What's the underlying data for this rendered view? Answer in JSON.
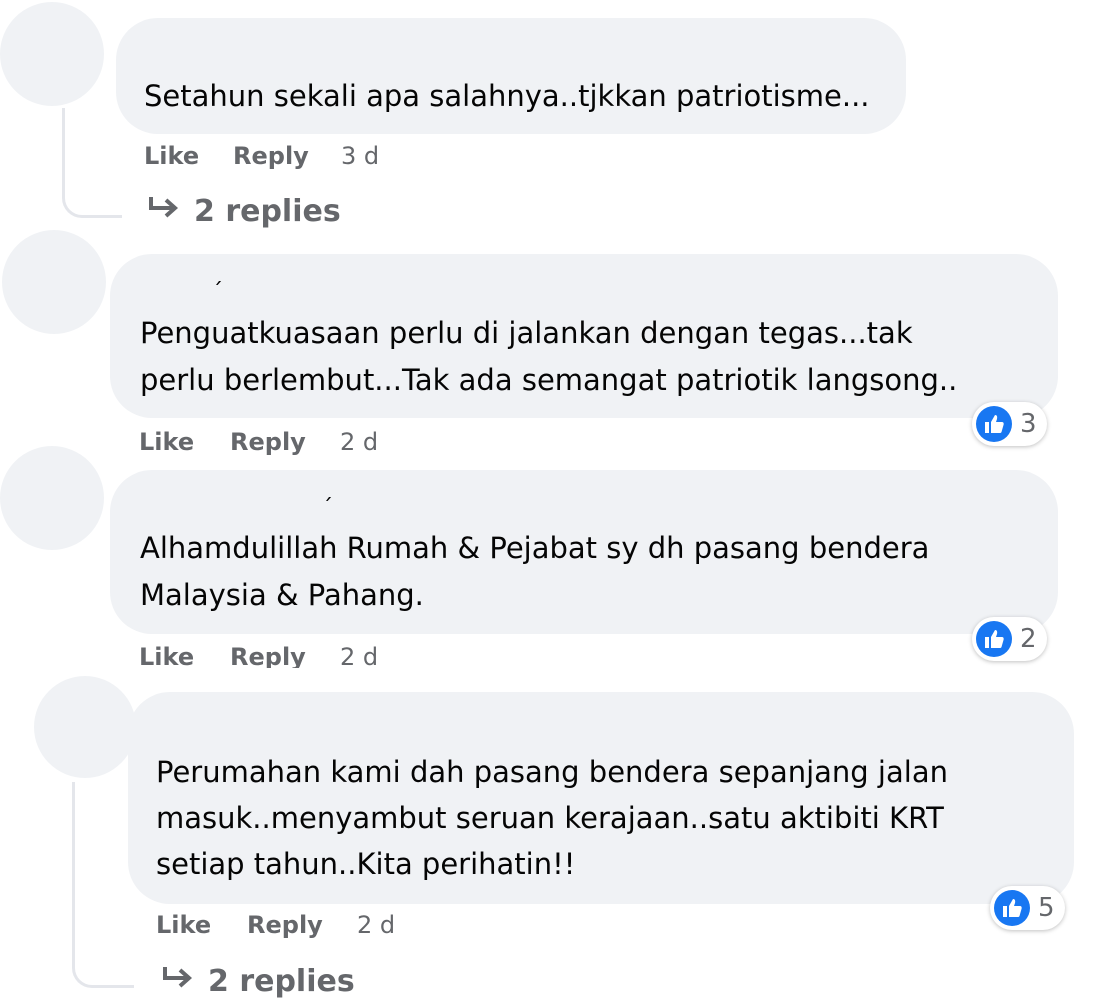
{
  "comments": [
    {
      "text_lines": [
        "Setahun sekali apa salahnya..tjkkan patriotisme..."
      ],
      "like_label": "Like",
      "reply_label": "Reply",
      "time": "3 d",
      "replies_label": "2 replies"
    },
    {
      "text_lines": [
        "Penguatkuasaan perlu di jalankan dengan tegas...tak",
        "perlu berlembut...Tak ada semangat patriotik langsong.."
      ],
      "like_label": "Like",
      "reply_label": "Reply",
      "time": "2 d",
      "reaction_count": "3"
    },
    {
      "text_lines": [
        "Alhamdulillah Rumah & Pejabat sy dh pasang bendera",
        "Malaysia & Pahang."
      ],
      "like_label": "Like",
      "reply_label": "Reply",
      "time": "2 d",
      "reaction_count": "2"
    },
    {
      "text_lines": [
        "Perumahan kami dah pasang bendera sepanjang jalan",
        "masuk..menyambut seruan kerajaan..satu aktibiti KRT",
        "setiap tahun..Kita perihatin!!"
      ],
      "like_label": "Like",
      "reply_label": "Reply",
      "time": "2 d",
      "reaction_count": "5",
      "replies_label": "2 replies"
    }
  ],
  "icons": {
    "reaction": "thumbs-up-icon",
    "reply_arrow": "reply-arrow-icon"
  },
  "colors": {
    "bubble": "#f0f2f5",
    "like_blue": "#1877f2",
    "meta_gray": "#65676b"
  }
}
